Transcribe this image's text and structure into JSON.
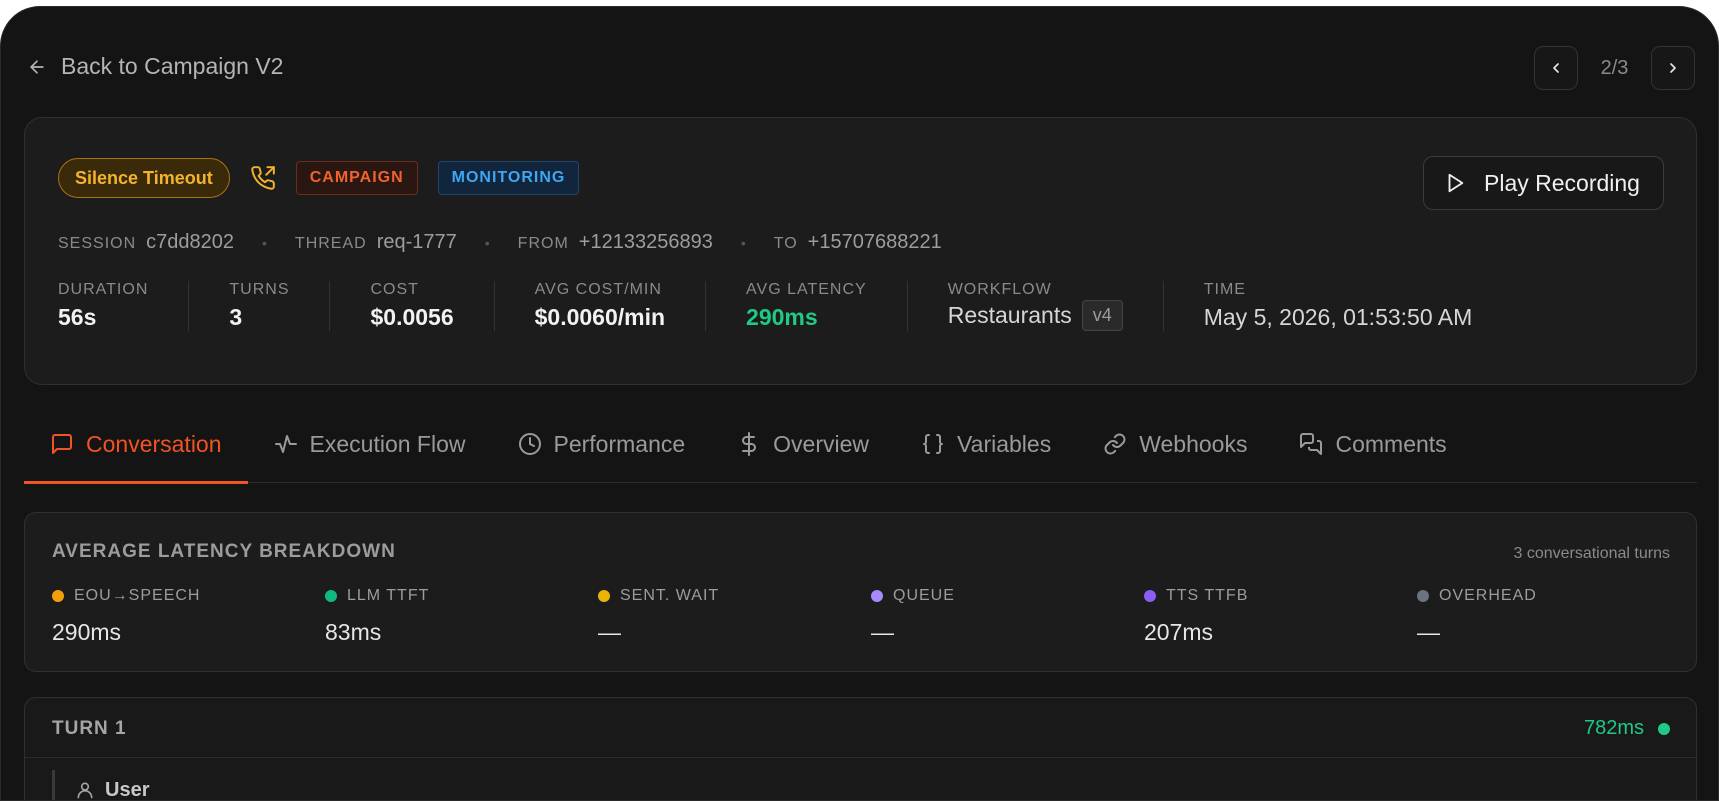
{
  "nav": {
    "back_label": "Back to Campaign V2",
    "pager": "2/3"
  },
  "session": {
    "status_tag": "Silence Timeout",
    "type_tags": [
      "CAMPAIGN",
      "MONITORING"
    ],
    "play_label": "Play Recording",
    "meta": [
      {
        "key": "SESSION",
        "value": "c7dd8202"
      },
      {
        "key": "THREAD",
        "value": "req-1777"
      },
      {
        "key": "FROM",
        "value": "+12133256893"
      },
      {
        "key": "TO",
        "value": "+15707688221"
      }
    ],
    "stats": {
      "duration": {
        "label": "DURATION",
        "value": "56s"
      },
      "turns": {
        "label": "TURNS",
        "value": "3"
      },
      "cost": {
        "label": "COST",
        "value": "$0.0056"
      },
      "avg_cost": {
        "label": "AVG COST/MIN",
        "value": "$0.0060/min"
      },
      "avg_latency": {
        "label": "AVG LATENCY",
        "value": "290ms"
      },
      "workflow": {
        "label": "WORKFLOW",
        "value": "Restaurants",
        "version": "v4"
      },
      "time": {
        "label": "TIME",
        "value": "May 5, 2026, 01:53:50 AM"
      }
    }
  },
  "tabs": [
    {
      "label": "Conversation",
      "icon": "message-square-icon",
      "active": true
    },
    {
      "label": "Execution Flow",
      "icon": "activity-icon"
    },
    {
      "label": "Performance",
      "icon": "clock-icon"
    },
    {
      "label": "Overview",
      "icon": "dollar-icon"
    },
    {
      "label": "Variables",
      "icon": "braces-icon"
    },
    {
      "label": "Webhooks",
      "icon": "link-icon"
    },
    {
      "label": "Comments",
      "icon": "messages-icon"
    }
  ],
  "latency": {
    "title": "AVERAGE LATENCY BREAKDOWN",
    "turns_note": "3 conversational turns",
    "items": [
      {
        "label": "EOU→SPEECH",
        "value": "290ms",
        "color": "#f59e0b"
      },
      {
        "label": "LLM TTFT",
        "value": "83ms",
        "color": "#10b981"
      },
      {
        "label": "SENT. WAIT",
        "value": "—",
        "color": "#eab308"
      },
      {
        "label": "QUEUE",
        "value": "—",
        "color": "#a78bfa"
      },
      {
        "label": "TTS TTFB",
        "value": "207ms",
        "color": "#8b5cf6"
      },
      {
        "label": "OVERHEAD",
        "value": "—",
        "color": "#6b7280"
      }
    ]
  },
  "turn": {
    "title": "TURN 1",
    "latency": "782ms",
    "speaker": "User"
  },
  "colors": {
    "accent": "#f25322",
    "success": "#20c985",
    "warning": "#f3b42b",
    "info": "#3ea6f2"
  }
}
